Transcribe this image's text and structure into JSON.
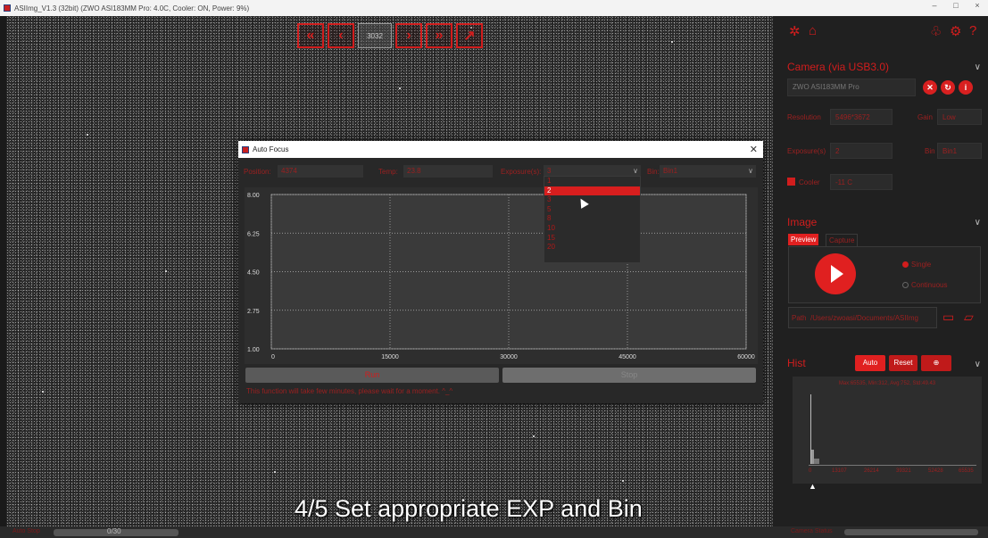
{
  "window": {
    "title": "ASIImg_V1.3 (32bit)  (ZWO ASI183MM Pro: 4.0C, Cooler: ON, Power: 9%)",
    "controls": [
      "–",
      "□",
      "×"
    ]
  },
  "image_toolbar": {
    "buttons": [
      "«",
      "‹",
      "›",
      "»",
      "↗"
    ],
    "center_label": "3032"
  },
  "status_bar": {
    "left_label": "Auto Stop",
    "progress_text": "0/30",
    "progress": 0
  },
  "subtitle": "4/5 Set appropriate EXP and Bin",
  "right_panel": {
    "top_icons": [
      "settings-icon",
      "camera-icon",
      "shirt-icon",
      "gear-icon",
      "help-icon"
    ],
    "camera_section": {
      "title": "Camera (via USB3.0)",
      "camera_name": "ZWO ASI183MM Pro",
      "resolution_label": "Resolution",
      "resolution_value": "5496*3672",
      "gain_label": "Gain",
      "gain_value": "Low",
      "exposure_label": "Exposure(s)",
      "exposure_value": "2",
      "bin_label": "Bin",
      "bin_value": "Bin1",
      "cooler_label": "Cooler",
      "cooler_value": "-11 C"
    },
    "image_section": {
      "title": "Image",
      "tabs": [
        "Preview",
        "Capture"
      ],
      "mode_single": "Single",
      "mode_continuous": "Continuous",
      "path_label": "Path",
      "path_value": "/Users/zwoasi/Documents/ASIImg"
    },
    "hist_section": {
      "title": "Hist",
      "auto_label": "Auto",
      "reset_label": "Reset",
      "stats": "Max:65535, Min:312, Avg:752, Std:49.43",
      "ticks": [
        "0",
        "13107",
        "26214",
        "39321",
        "52428",
        "65535"
      ]
    },
    "footer_label": "Camera Status"
  },
  "dialog": {
    "title": "Auto Focus",
    "position_label": "Position:",
    "position_value": "4374",
    "temp_label": "Temp:",
    "temp_value": "23.8",
    "exposure_label": "Exposure(s):",
    "exposure_value": "3",
    "bin_label": "Bin:",
    "bin_value": "Bin1",
    "exposure_options": [
      "1",
      "2",
      "3",
      "5",
      "8",
      "10",
      "15",
      "20"
    ],
    "selected_option": "2",
    "run_label": "Run",
    "stop_label": "Stop",
    "message": "This function will take few minutes, please wait for a moment. ^_^"
  },
  "chart_data": {
    "type": "line",
    "xlim": [
      0,
      60000
    ],
    "ylim": [
      1.0,
      8.0
    ],
    "x_ticks": [
      "0",
      "15000",
      "30000",
      "45000",
      "60000"
    ],
    "y_ticks": [
      "1.00",
      "2.75",
      "4.50",
      "6.25",
      "8.00"
    ],
    "series": [],
    "grid": true
  },
  "colors": {
    "accent": "#d11d1d",
    "panel_bg": "#202020",
    "dialog_bg": "#282828"
  }
}
